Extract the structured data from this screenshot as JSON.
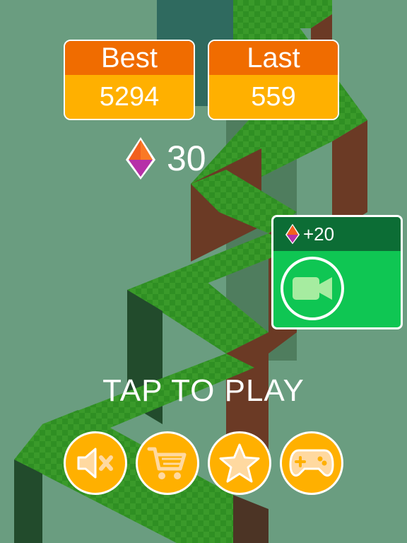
{
  "scores": {
    "best": {
      "label": "Best",
      "value": "5294"
    },
    "last": {
      "label": "Last",
      "value": "559"
    }
  },
  "gems": {
    "count": "30",
    "icon": "gem-icon"
  },
  "reward": {
    "amount": "+20",
    "icon": "video-camera-icon"
  },
  "prompt": "TAP TO PLAY",
  "buttons": [
    {
      "name": "sound-off-button",
      "icon": "speaker-mute-icon"
    },
    {
      "name": "shop-button",
      "icon": "cart-icon"
    },
    {
      "name": "rate-button",
      "icon": "star-icon"
    },
    {
      "name": "more-games-button",
      "icon": "gamepad-icon"
    }
  ],
  "colors": {
    "background": "#6a9d80",
    "orange_header": "#f06c00",
    "orange_value": "#ffb000",
    "reward_top": "#0c6d35",
    "reward_body": "#0fc653",
    "grass": "#2f8f23"
  }
}
